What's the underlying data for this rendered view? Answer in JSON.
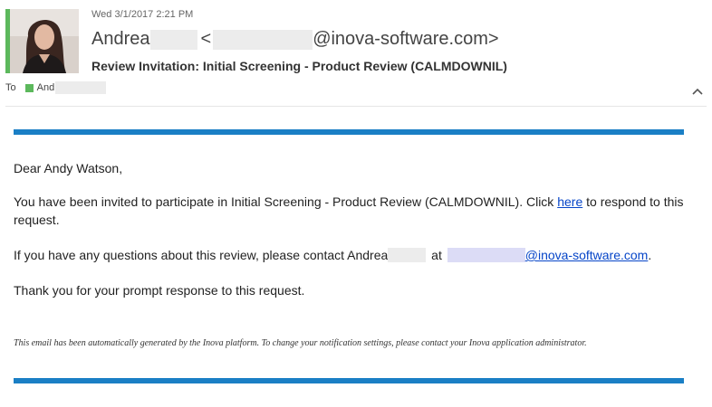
{
  "header": {
    "sent_date": "Wed 3/1/2017 2:21 PM",
    "sender_name": "Andrea",
    "sender_email_open": "<",
    "sender_email_domain": "@inova-software.com>",
    "subject": "Review Invitation: Initial Screening - Product Review (CALMDOWNIL)",
    "to_label": "To",
    "recipient_name": "And",
    "presence_color": "#5cb85c"
  },
  "body": {
    "greeting": "Dear Andy Watson,",
    "invite_text_before_link": "You have been invited to participate in Initial Screening - Product Review (CALMDOWNIL). Click ",
    "invite_link_label": "here",
    "invite_text_after_link": " to respond to this request.",
    "questions_text_before_name": "If you have any questions about this review, please contact Andrea",
    "questions_text_at": " at ",
    "contact_email_domain": "@inova-software.com",
    "questions_text_end": ".",
    "thanks_text": "Thank you for your prompt response to this request.",
    "footer_note": "This email has been automatically generated by the Inova platform. To change your notification settings, please contact your Inova application administrator.",
    "accent_color": "#1a7fc5",
    "link_color": "#0645c8"
  },
  "icons": {
    "collapse": "chevron-up-icon"
  }
}
